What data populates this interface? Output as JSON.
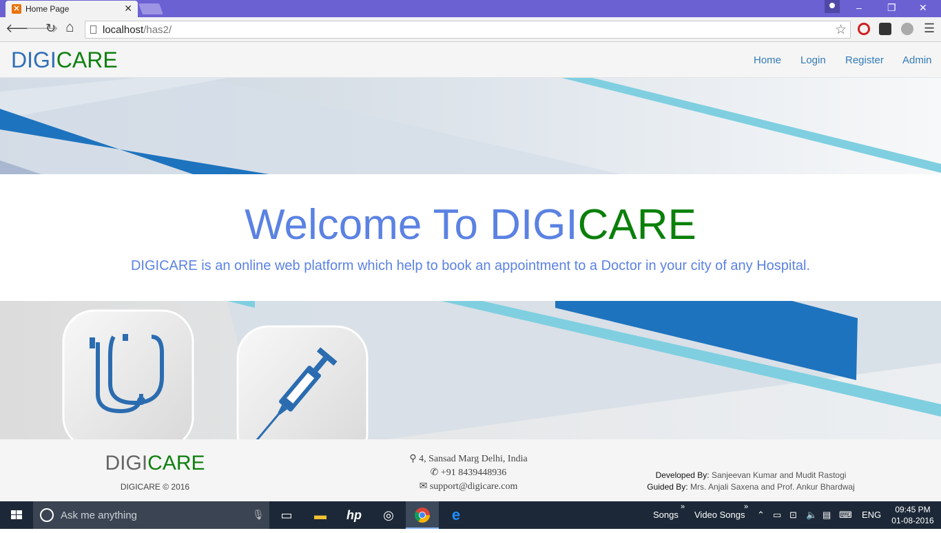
{
  "browser": {
    "tab_title": "Home Page",
    "tab_close": "✕",
    "url_host": "localhost",
    "url_path": "/has2/",
    "window_controls": {
      "minimize": "–",
      "restore": "❐",
      "close": "✕"
    },
    "toolbar_icons": {
      "back": "🡐",
      "forward": "🡒",
      "reload": "↻",
      "home": "⌂",
      "menu": "☰",
      "star": "☆"
    }
  },
  "site": {
    "brand_part1": "DIGI",
    "brand_part2": "CARE",
    "nav": [
      {
        "label": "Home"
      },
      {
        "label": "Login"
      },
      {
        "label": "Register"
      },
      {
        "label": "Admin"
      }
    ],
    "hero": {
      "title_part1": "Welcome To DIGI",
      "title_part2": "CARE",
      "subtitle": "DIGICARE is an online web platform which help to book an appointment to a Doctor in your city of any Hospital."
    },
    "footer": {
      "brand_part1": "DIGI",
      "brand_part2": "CARE",
      "copyright": "DIGICARE © 2016",
      "address": "4,  Sansad Marg Delhi, India",
      "phone": "+91 8439448936",
      "email": "support@digicare.com",
      "developed_label": "Developed By:",
      "developed_value": "Sanjeevan Kumar and Mudit Rastogi",
      "guided_label": "Guided By:",
      "guided_value": "Mrs. Anjali Saxena and Prof. Ankur Bhardwaj"
    }
  },
  "taskbar": {
    "search_placeholder": "Ask me anything",
    "tray_songs": "Songs",
    "tray_video_songs": "Video Songs",
    "chevron": "»",
    "language": "ENG",
    "time": "09:45 PM",
    "date": "01-08-2016"
  },
  "colors": {
    "browser_frame": "#6c61d3",
    "brand_blue": "#2f6fb7",
    "brand_green": "#108010",
    "hero_blue": "#5b82e3",
    "banner_blue": "#1e73be",
    "banner_cyan": "#7fcfe0"
  }
}
